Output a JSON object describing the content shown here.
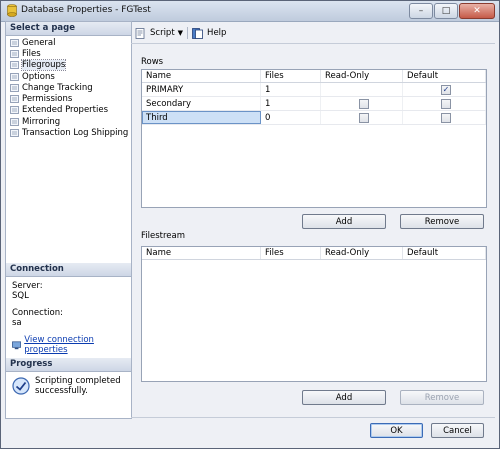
{
  "window": {
    "title": "Database Properties - FGTest"
  },
  "left": {
    "select_heading": "Select a page",
    "pages": [
      "General",
      "Files",
      "Filegroups",
      "Options",
      "Change Tracking",
      "Permissions",
      "Extended Properties",
      "Mirroring",
      "Transaction Log Shipping"
    ],
    "selected_page": "Filegroups",
    "connection_heading": "Connection",
    "server_label": "Server:",
    "server_value": "SQL",
    "connection_label": "Connection:",
    "connection_value": "sa",
    "view_link": "View connection properties",
    "progress_heading": "Progress",
    "progress_line1": "Scripting completed",
    "progress_line2": "successfully."
  },
  "toolbar": {
    "script_label": "Script",
    "help_label": "Help"
  },
  "rows_section": {
    "label": "Rows",
    "columns": [
      "Name",
      "Files",
      "Read-Only",
      "Default"
    ],
    "rows": [
      {
        "name": "PRIMARY",
        "files": "1",
        "readonly": null,
        "default": true
      },
      {
        "name": "Secondary",
        "files": "1",
        "readonly": false,
        "default": false
      },
      {
        "name": "Third",
        "files": "0",
        "readonly": false,
        "default": false
      }
    ],
    "add_label": "Add",
    "remove_label": "Remove"
  },
  "filestream_section": {
    "label": "Filestream",
    "columns": [
      "Name",
      "Files",
      "Read-Only",
      "Default"
    ],
    "add_label": "Add",
    "remove_label": "Remove"
  },
  "footer": {
    "ok_label": "OK",
    "cancel_label": "Cancel"
  }
}
